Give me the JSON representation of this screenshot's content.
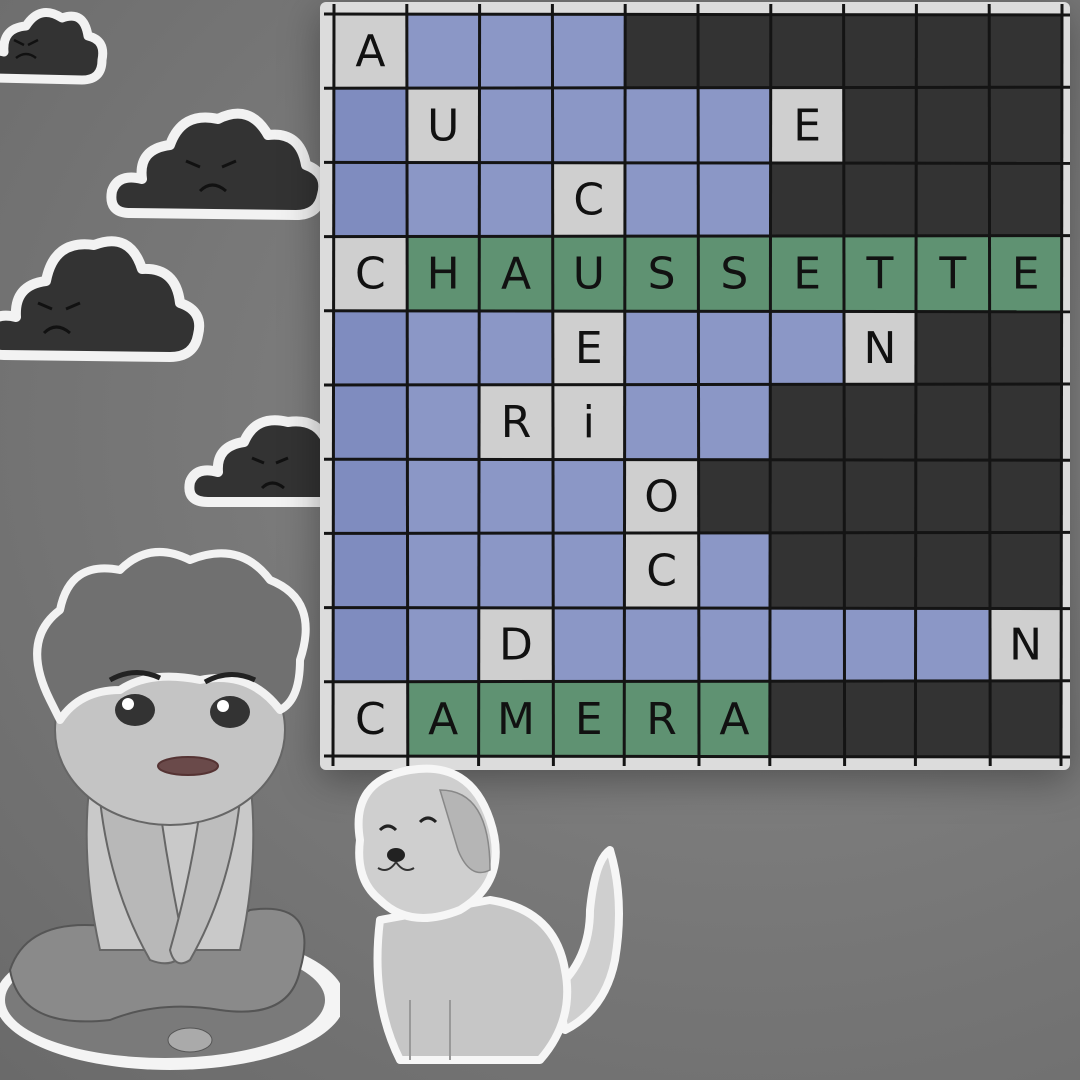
{
  "colors": {
    "blue": "#8b97c6",
    "blue_dark": "#7f8cbf",
    "gray": "#cfcfcf",
    "green": "#5f9272",
    "dark": "#333333",
    "grid_line": "#141414"
  },
  "icons": {
    "clouds": [
      "sad-cloud-icon",
      "sad-cloud-icon",
      "sad-cloud-icon",
      "sad-cloud-icon"
    ],
    "child": "sad-child-illustration",
    "dog": "happy-dog-illustration"
  },
  "grid": {
    "rows": [
      "gbbbdddddd",
      "bgbbbbgddd",
      "bbbgbbdddd",
      "gGGGGGGGGG",
      "bbbgbbbgdd",
      "bbggbbdddd",
      "bbbbgddddd",
      "bbbbgbdddd",
      "bbgbbbbbbg",
      "gGGGGGdddd"
    ],
    "letters": [
      [
        "A",
        "",
        "",
        "",
        "",
        "",
        "",
        "",
        "",
        ""
      ],
      [
        "",
        "U",
        "",
        "",
        "",
        "",
        "E",
        "",
        "",
        ""
      ],
      [
        "",
        "",
        "",
        "C",
        "",
        "",
        "",
        "",
        "",
        ""
      ],
      [
        "C",
        "H",
        "A",
        "U",
        "S",
        "S",
        "E",
        "T",
        "T",
        "E"
      ],
      [
        "",
        "",
        "",
        "E",
        "",
        "",
        "",
        "N",
        "",
        ""
      ],
      [
        "",
        "",
        "R",
        "i",
        "",
        "",
        "",
        "",
        "",
        ""
      ],
      [
        "",
        "",
        "",
        "",
        "O",
        "",
        "",
        "",
        "",
        ""
      ],
      [
        "",
        "",
        "",
        "",
        "C",
        "",
        "",
        "",
        "",
        ""
      ],
      [
        "",
        "",
        "D",
        "",
        "",
        "",
        "",
        "",
        "",
        "N"
      ],
      [
        "C",
        "A",
        "M",
        "E",
        "R",
        "A",
        "",
        "",
        "",
        ""
      ]
    ]
  }
}
